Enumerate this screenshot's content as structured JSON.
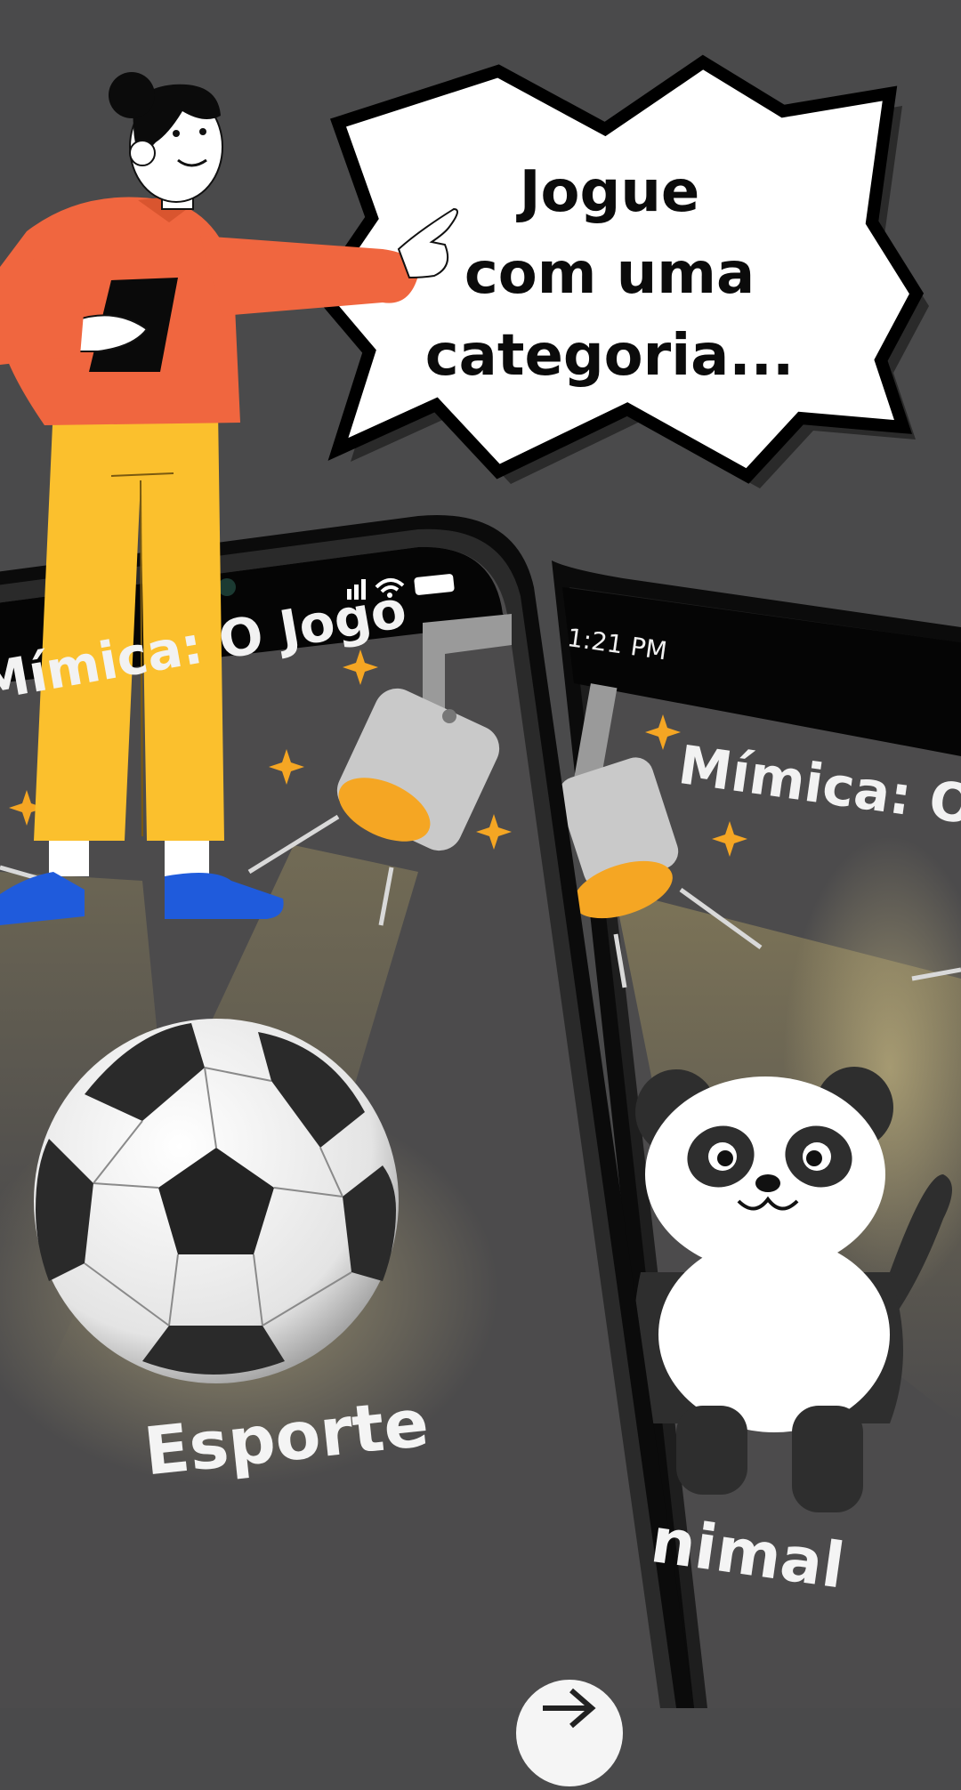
{
  "speech_bubble": {
    "line1": "Jogue",
    "line2": "com uma",
    "line3": "categoria..."
  },
  "phone_left": {
    "title": "Mímica: O Jogo",
    "category_label": "Esporte",
    "category_icon": "soccer-ball-icon"
  },
  "phone_right": {
    "time": "1:21 PM",
    "title": "Mímica: O J",
    "category_label": "nimal",
    "category_icon": "panda-icon"
  },
  "next_button": {
    "icon": "arrow-right-icon"
  },
  "colors": {
    "background": "#4a4a4b",
    "accent_orange": "#f0663f",
    "accent_yellow": "#fbc02d",
    "sparkle": "#f5a623",
    "shoe_blue": "#1f5bdc"
  }
}
